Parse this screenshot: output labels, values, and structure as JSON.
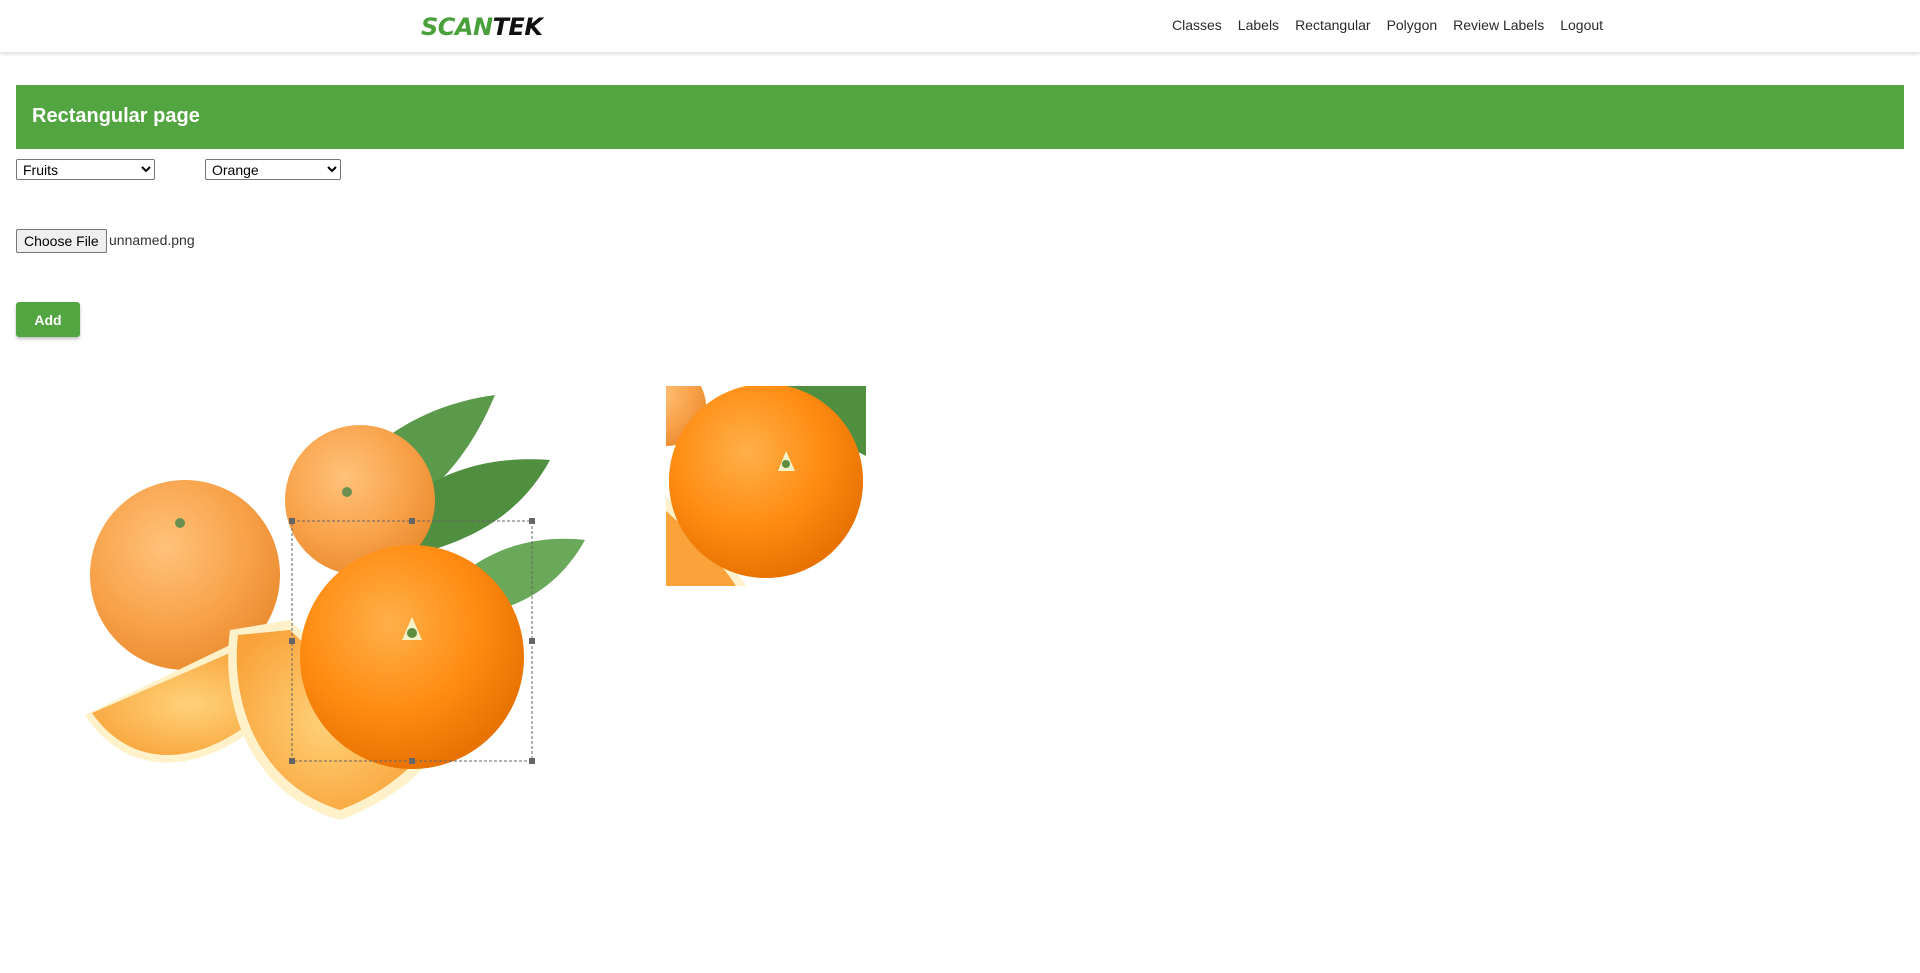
{
  "navbar": {
    "logo_part1": "SCAN",
    "logo_part2": "TEK",
    "links": [
      "Classes",
      "Labels",
      "Rectangular",
      "Polygon",
      "Review Labels",
      "Logout"
    ]
  },
  "page": {
    "title": "Rectangular page"
  },
  "form": {
    "class_select": {
      "selected": "Fruits"
    },
    "label_select": {
      "selected": "Orange"
    },
    "file": {
      "button_label": "Choose File",
      "file_name": "unnamed.png"
    },
    "add_label": "Add"
  },
  "colors": {
    "brand_green": "#52a541",
    "orange": "#f58b1a"
  },
  "icons": {
    "crop_handles": "square-handle-icon"
  }
}
